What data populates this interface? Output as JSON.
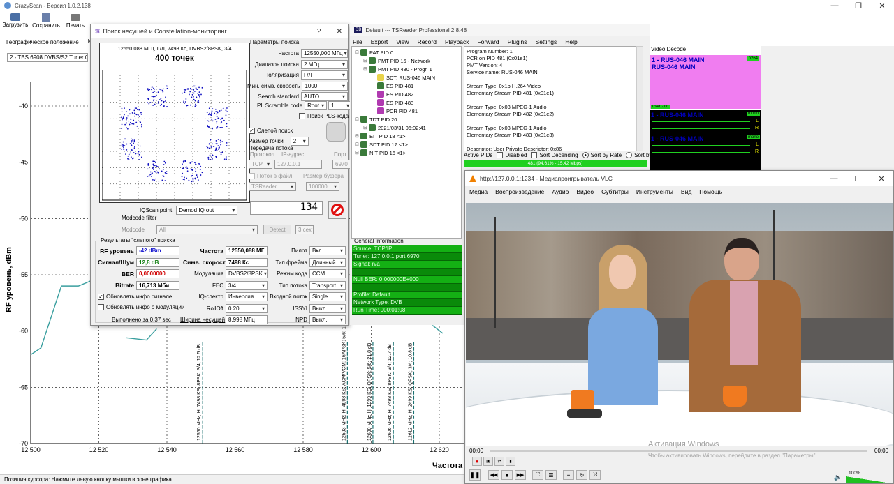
{
  "crazyscan": {
    "title": "CrazyScan - Версия 1.0.2.138",
    "toolbar": [
      "Загрузить",
      "Сохранить",
      "Печать"
    ],
    "tabs": [
      "Географическое положение",
      "Ин"
    ],
    "tuner": "2 - TBS 6908 DVBS/S2 Tuner 0",
    "ylabel": "RF уровень, dBm",
    "xlabel": "Частота",
    "statusbar": "Позиция курсора: Нажмите левую кнопку мышки в зоне графика"
  },
  "chart_data": {
    "type": "line",
    "xlabel": "Частота",
    "ylabel": "RF уровень, dBm",
    "xlim": [
      12500,
      12625
    ],
    "ylim": [
      -70,
      -37.5
    ],
    "xticks": [
      "12 500",
      "12 520",
      "12 540",
      "12 560",
      "12 580",
      "12 600",
      "12 620"
    ],
    "yticks": [
      "-40",
      "-45",
      "-50",
      "-55",
      "-60",
      "-65",
      "-70"
    ],
    "series": [
      {
        "x": [
          12500,
          12503,
          12509,
          12514,
          12518,
          12522
        ],
        "y": [
          -62.1,
          -61.5,
          -56.0,
          -56.0,
          -55.5,
          -56.2
        ]
      },
      {
        "x": [
          12528,
          12534,
          12537
        ],
        "y": [
          -60.6,
          -60.8,
          -59.8
        ]
      },
      {
        "x": [
          12618,
          12621
        ],
        "y": [
          -59.5,
          -60.2
        ]
      }
    ],
    "markers": [
      {
        "x": 12550.5,
        "label": "12550 MHz; H; 7498 KS; 8PSK; 3/4; 12.5 dB"
      },
      {
        "x": 12593,
        "label": "12593 MHz; H; 4998 KS; ACM/VCM; 16APSK; 5/6; 13"
      },
      {
        "x": 12600.5,
        "label": "12600 MHz; H; 1999 KS; QPSK; 5/6; 21.8 dB"
      },
      {
        "x": 12606.5,
        "label": "12606 MHz; H; 7498 KS; 8PSK; 3/4; 12.7 dB"
      },
      {
        "x": 12612.5,
        "label": "12612 MHz; H; 2499 KS; QPSK; 3/4; 10.8 dB"
      }
    ]
  },
  "dialog": {
    "title": "Поиск несущей и Constellation-мониторинг",
    "help": "?",
    "close": "✕",
    "const_header": "12550,088 МГц, Г/Л, 7498 Кс, DVBS2/8PSK, 3/4",
    "const_points": "400 точек",
    "search_params_title": "Параметры поиска",
    "params": [
      {
        "label": "Частота",
        "value": "12550,000 МГц",
        "type": "spin"
      },
      {
        "label": "Диапазон поиска",
        "value": "2 МГц",
        "type": "spin"
      },
      {
        "label": "Поляризация",
        "value": "Г/Л",
        "type": "spin"
      },
      {
        "label": "Мин. симв. скорость",
        "value": "1000",
        "type": "dd"
      },
      {
        "label": "Search standard",
        "value": "AUTO",
        "type": "spin"
      }
    ],
    "pl_scramble_label": "PL Scramble code",
    "pl_scramble_mode": "Root",
    "pl_scramble_value": "1",
    "pls_search": "Поиск PLS-кода",
    "blind_search": "Слепой поиск",
    "point_size_label": "Размер точки",
    "point_size": "2",
    "stream_title": "Передача потока",
    "proto_label": "Протокол",
    "ip_label": "IP-адрес",
    "port_label": "Порт",
    "proto": "TCP",
    "ip": "127.0.0.1",
    "port": "6970",
    "to_file": "Поток в файл",
    "buffer_label": "Размер буфера",
    "file_app": "TSReader",
    "buffer": "100000",
    "iqscan_label": "IQScan point",
    "iqscan_value": "Demod IQ out",
    "modcode_filter": "Modcode filter",
    "modcode_label": "Modcode",
    "modcode_value": "All",
    "detect": "Detect",
    "detect_time": "3 сек",
    "counter": "134",
    "results_title": "Результаты \"слепого\" поиска",
    "rf_label": "RF уровень",
    "rf_value": "-42 dBm",
    "snr_label": "Сигнал/Шум",
    "snr_value": "12,8 dB",
    "ber_label": "BER",
    "ber_value": "0,0000000",
    "bitrate_label": "Bitrate",
    "bitrate_value": "16,713 Мби",
    "freq_label": "Частота",
    "freq_value": "12550,088 МГ",
    "sr_label": "Симв. скорость",
    "sr_value": "7498 Кс",
    "mod_label": "Модуляция",
    "mod_value": "DVBS2/8PSK",
    "fec_label": "FEC",
    "fec_value": "3/4",
    "iq_label": "IQ-спектр",
    "iq_value": "Инверсия",
    "rolloff_label": "RollOff",
    "rolloff_value": "0.20",
    "bw_label": "Ширина несущей",
    "bw_value": "8,998 МГц",
    "pilot_label": "Пилот",
    "pilot_value": "Вкл.",
    "frame_label": "Тип фрейма",
    "frame_value": "Длинный",
    "code_label": "Режим кода",
    "code_value": "CCM",
    "stream_type_label": "Тип потока",
    "stream_type_value": "Transport",
    "input_label": "Входной поток",
    "input_value": "Single",
    "issyi_label": "ISSYI",
    "issyi_value": "Выкл.",
    "npd_label": "NPD",
    "npd_value": "Выкл.",
    "upd_signal": "Обновлять инфо сигнале",
    "upd_mod": "Обновлять инфо о модуляции",
    "done": "Выполнено за 0.37 sec"
  },
  "tsreader": {
    "title": "Default --- TSReader Professional 2.8.48",
    "menu": [
      "File",
      "Export",
      "View",
      "Record",
      "Playback",
      "Forward",
      "Plugins",
      "Settings",
      "Help"
    ],
    "tree": [
      {
        "t": "PAT PID 0",
        "lvl": 0,
        "c": "#3a7a3a"
      },
      {
        "t": "PMT PID 16 - Network",
        "lvl": 1,
        "c": "#3a7a3a"
      },
      {
        "t": "PMT PID 480 - Progr. 1",
        "lvl": 1,
        "c": "#3a7a3a"
      },
      {
        "t": "SDT: RUS-046 MAIN",
        "lvl": 2,
        "c": "#e8d34a"
      },
      {
        "t": "ES PID 481",
        "lvl": 2,
        "c": "#3a7a3a"
      },
      {
        "t": "ES PID 482",
        "lvl": 2,
        "c": "#b03ab0"
      },
      {
        "t": "ES PID 483",
        "lvl": 2,
        "c": "#b03ab0"
      },
      {
        "t": "PCR PID 481",
        "lvl": 2,
        "c": "#b03ab0"
      },
      {
        "t": "TDT PID 20",
        "lvl": 0,
        "c": "#3a7a3a"
      },
      {
        "t": "2021/03/31 06:02:41",
        "lvl": 1,
        "c": "#3a7a3a"
      },
      {
        "t": "EIT PID 18 <1>",
        "lvl": 0,
        "c": "#3a7a3a"
      },
      {
        "t": "SDT PID 17 <1>",
        "lvl": 0,
        "c": "#3a7a3a"
      },
      {
        "t": "NIT PID 16 <1>",
        "lvl": 0,
        "c": "#3a7a3a"
      }
    ],
    "info": [
      "Program Number: 1",
      "PCR on PID 481 (0x01e1)",
      "PMT Version: 4",
      "Service name: RUS-046 MAIN",
      "",
      "Stream Type: 0x1b H.264 Video",
      "Elementary Stream PID 481 (0x01e1)",
      "",
      "Stream Type: 0x03 MPEG-1 Audio",
      "Elementary Stream PID 482 (0x01e2)",
      "",
      "Stream Type: 0x03 MPEG-1 Audio",
      "Elementary Stream PID 483 (0x01e3)",
      "",
      "Descriptor: User Private Descriptor: 0x86"
    ],
    "gen_title": "General Information",
    "gen": [
      "Source: TCP/IP",
      "Tuner: 127.0.0.1 port 6970",
      "Signal: n/a",
      "",
      "Null BER: 0.000000E+000",
      "",
      "Profile: Default",
      "Network Type: DVB",
      "Run Time: 000:01:08"
    ],
    "video_title": "Video Decode",
    "vd1": "1 - RUS-046 MAIN",
    "vd2": "RUS-046 MAIN",
    "h264": "h264",
    "user_cc": "user · cc",
    "ad1": "1 - RUS-046 MAIN",
    "ad2": "1 - RUS-046 MAIN",
    "mono": "mono",
    "L": "L",
    "R": "R",
    "active_pids": "Active PIDs",
    "disabled": "Disabled",
    "sort_desc": "Sort Decending",
    "sort_rate": "Sort by Rate",
    "sort_pid": "Sort by PID",
    "pid_bar": "481 (94.61% - 15.42 Mbps)"
  },
  "vlc": {
    "title": "http://127.0.0.1:1234 - Медиапроигрыватель VLC",
    "menu": [
      "Медиа",
      "Воспроизведение",
      "Аудио",
      "Видео",
      "Субтитры",
      "Инструменты",
      "Вид",
      "Помощь"
    ],
    "time_left": "00:00",
    "time_right": "00:00",
    "volume": "100%",
    "activation1": "Активация Windows",
    "activation2": "Чтобы активировать Windows, перейдите в раздел \"Параметры\"."
  }
}
